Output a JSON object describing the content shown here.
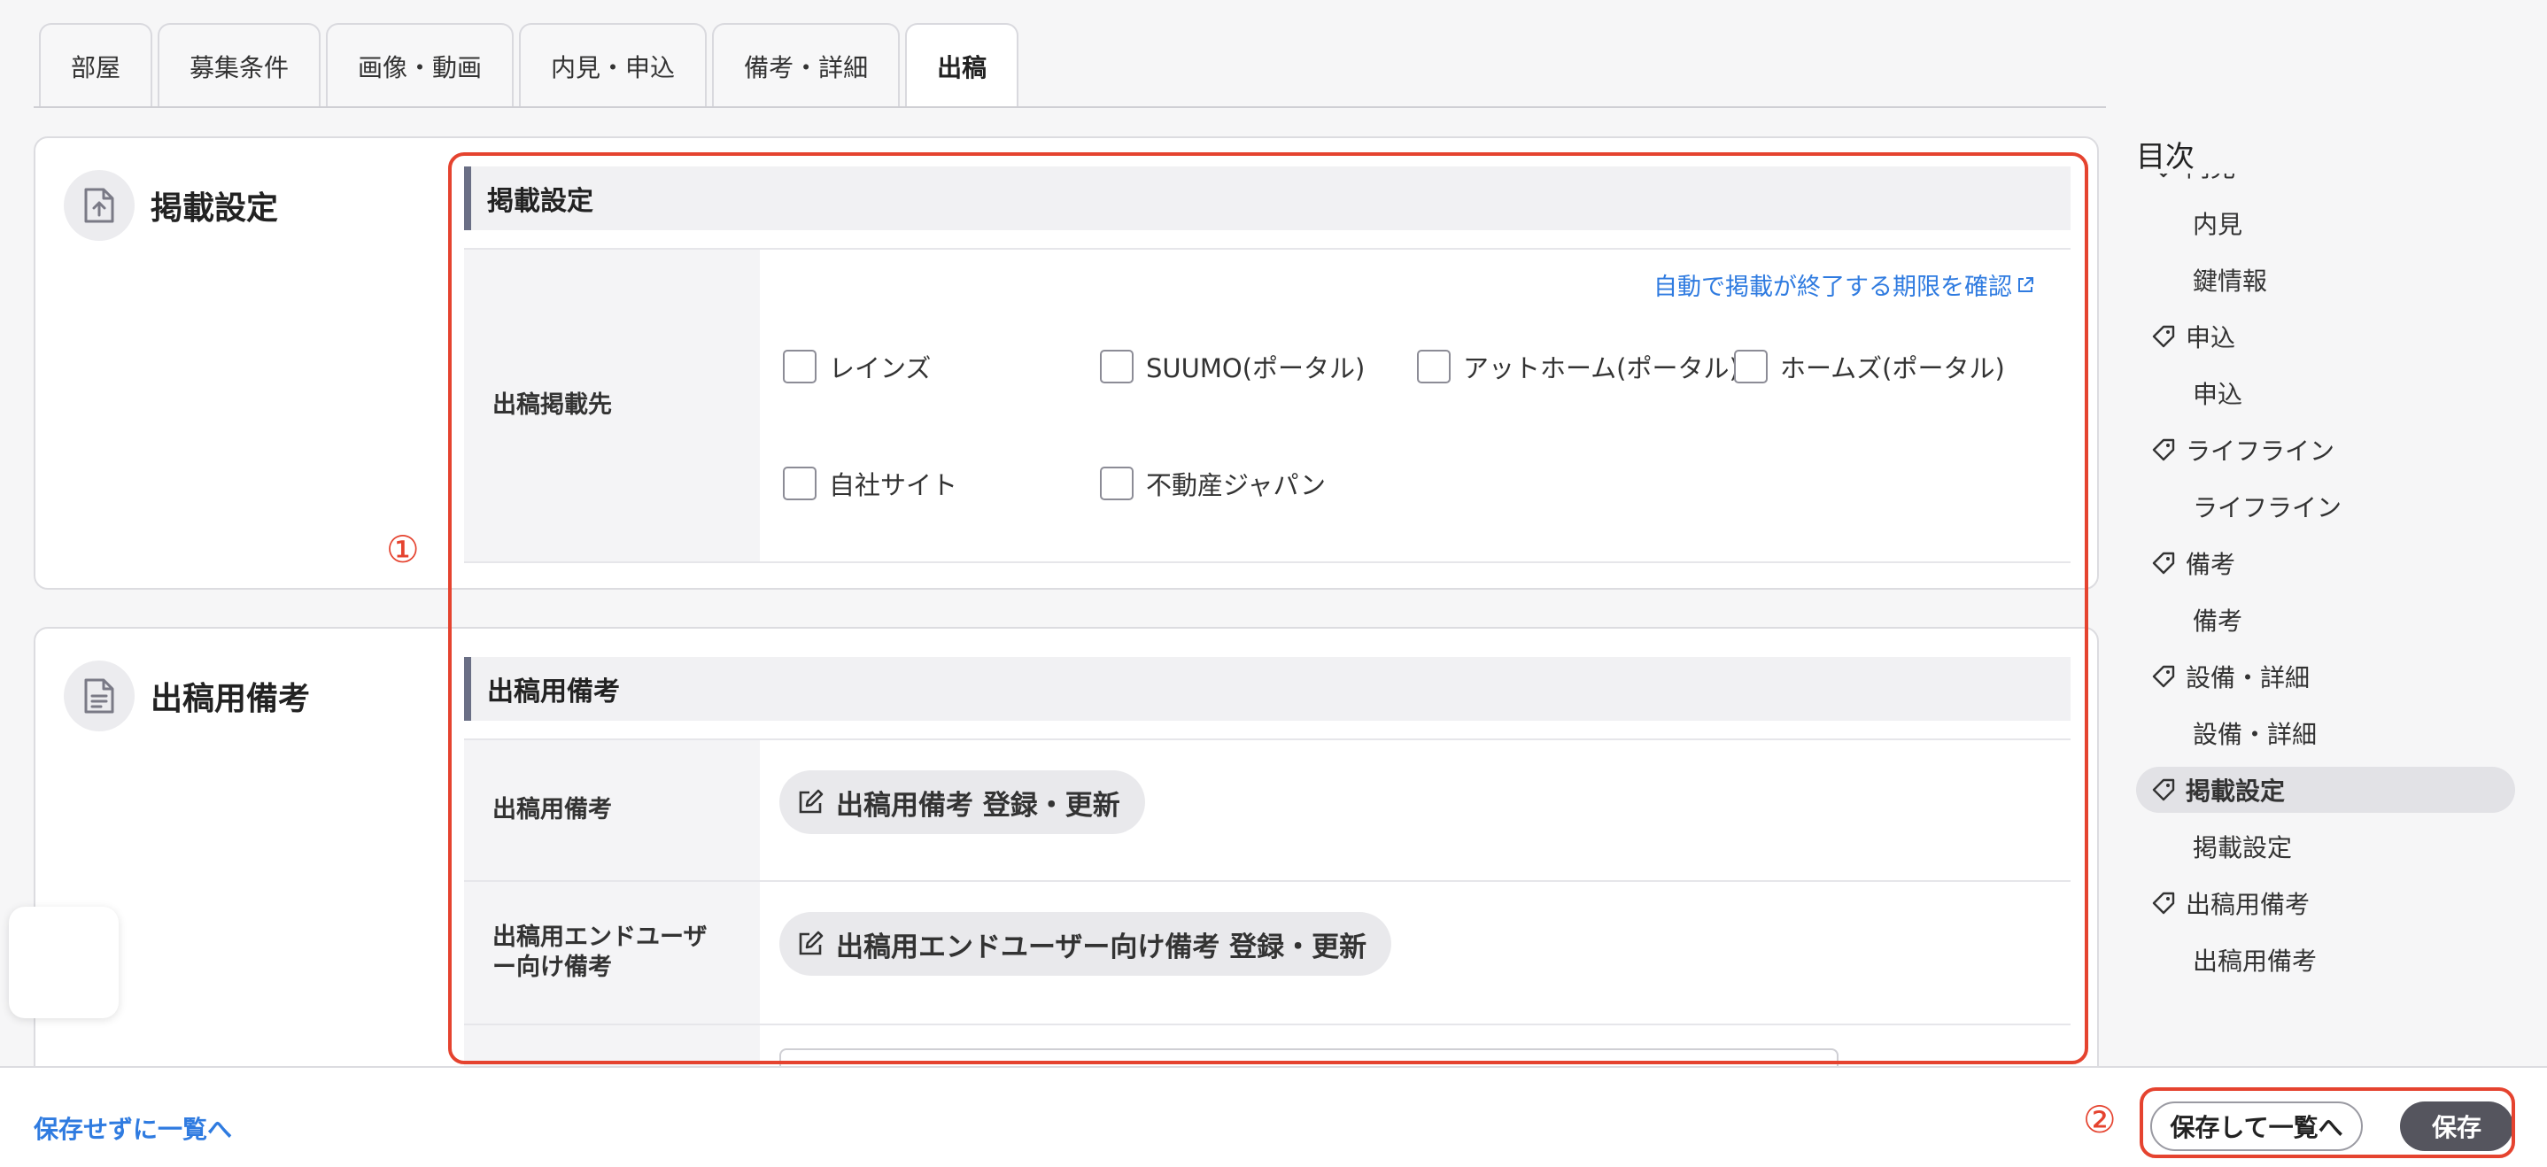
{
  "tabs": [
    {
      "label": "部屋"
    },
    {
      "label": "募集条件"
    },
    {
      "label": "画像・動画"
    },
    {
      "label": "内見・申込"
    },
    {
      "label": "備考・詳細"
    },
    {
      "label": "出稿",
      "active": true
    }
  ],
  "card1": {
    "title": "掲載設定",
    "icon": "upload-file-icon",
    "section_title": "掲載設定",
    "row_label": "出稿掲載先",
    "link_text": "自動で掲載が終了する期限を確認",
    "checkboxes_row1": [
      "レインズ",
      "SUUMO(ポータル)",
      "アットホーム(ポータル)",
      "ホームズ(ポータル)"
    ],
    "checkboxes_row2": [
      "自社サイト",
      "不動産ジャパン"
    ]
  },
  "card2": {
    "title": "出稿用備考",
    "icon": "document-icon",
    "section_title": "出稿用備考",
    "row1_label": "出稿用備考",
    "row1_button": "出稿用備考 登録・更新",
    "row2_label_line1": "出稿用エンドユーザ",
    "row2_label_line2": "ー向け備考",
    "row2_button": "出稿用エンドユーザー向け備考 登録・更新"
  },
  "annotations": {
    "one": "①",
    "two": "②",
    "color": "#e5432f"
  },
  "toc": {
    "title": "目次",
    "items": [
      {
        "label": "内見",
        "type": "parent"
      },
      {
        "label": "内見",
        "type": "child"
      },
      {
        "label": "鍵情報",
        "type": "child"
      },
      {
        "label": "申込",
        "type": "parent"
      },
      {
        "label": "申込",
        "type": "child"
      },
      {
        "label": "ライフライン",
        "type": "parent"
      },
      {
        "label": "ライフライン",
        "type": "child"
      },
      {
        "label": "備考",
        "type": "parent"
      },
      {
        "label": "備考",
        "type": "child"
      },
      {
        "label": "設備・詳細",
        "type": "parent"
      },
      {
        "label": "設備・詳細",
        "type": "child"
      },
      {
        "label": "掲載設定",
        "type": "parent",
        "active": true
      },
      {
        "label": "掲載設定",
        "type": "child"
      },
      {
        "label": "出稿用備考",
        "type": "parent"
      },
      {
        "label": "出稿用備考",
        "type": "child"
      }
    ]
  },
  "footer": {
    "back_link": "保存せずに一覧へ",
    "save_and_list": "保存して一覧へ",
    "save": "保存"
  },
  "colors": {
    "link": "#2f7be0",
    "accent_bar": "#6a6f85",
    "save_button": "#55555e"
  }
}
